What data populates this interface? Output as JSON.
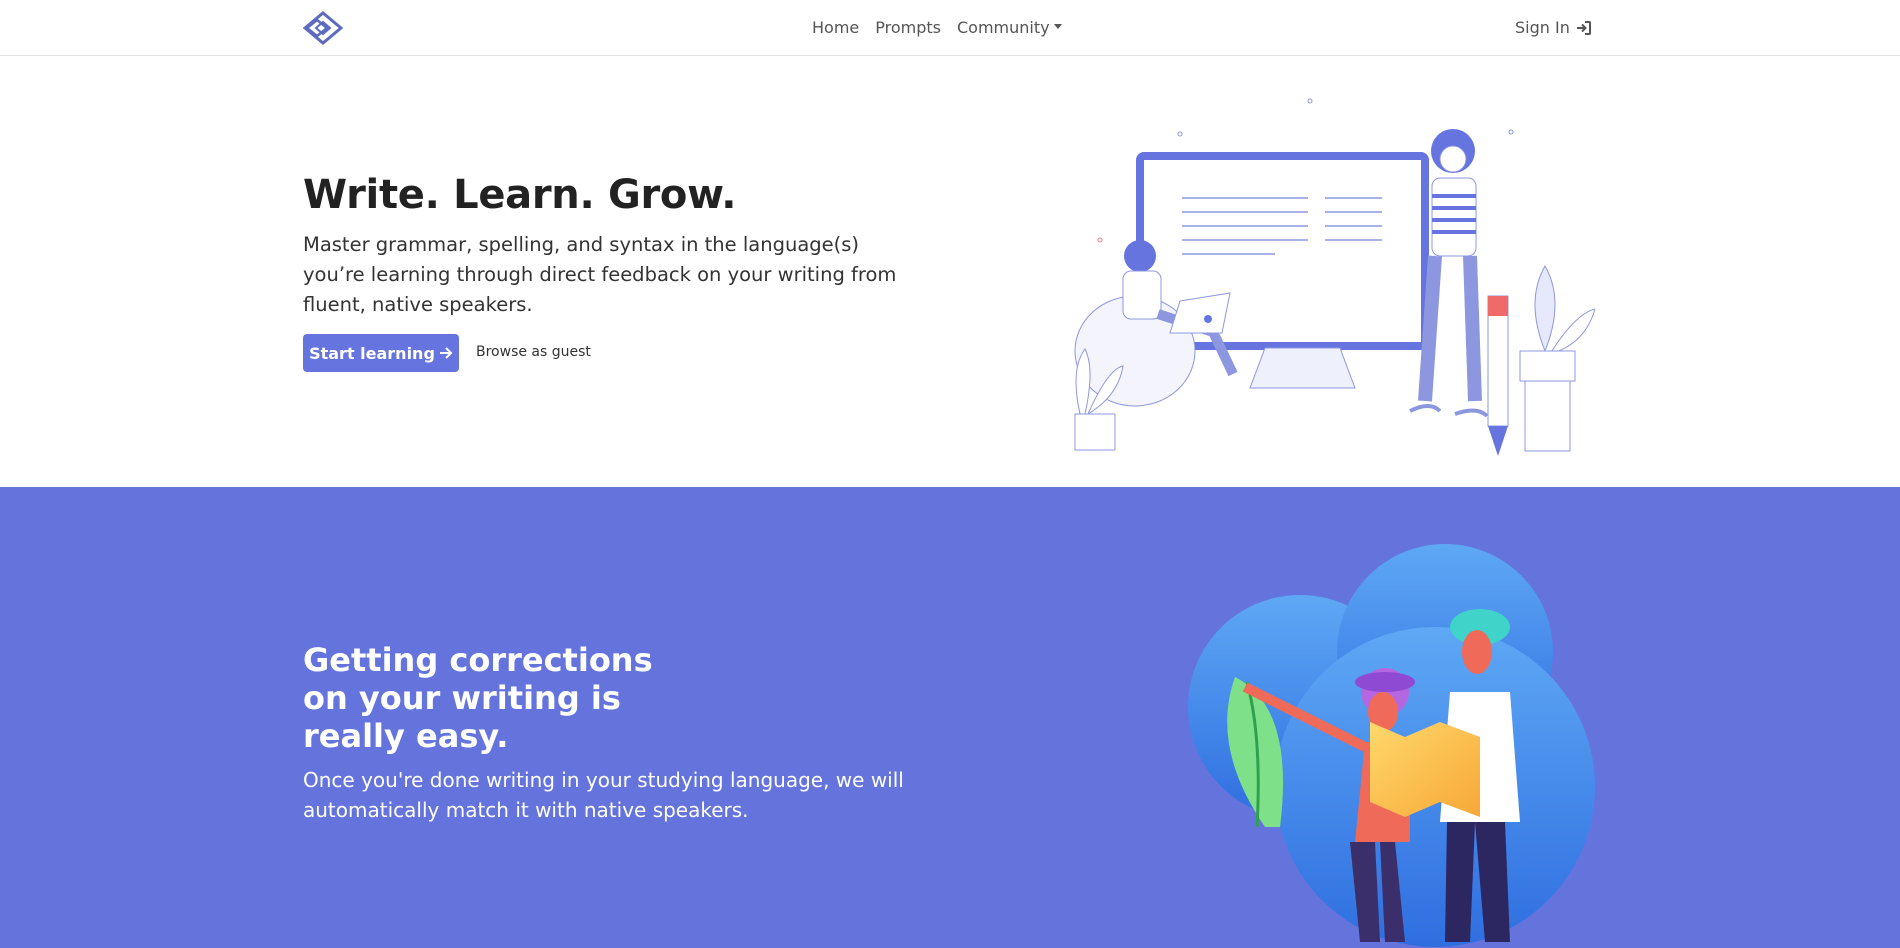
{
  "nav": {
    "links": [
      {
        "label": "Home"
      },
      {
        "label": "Prompts"
      },
      {
        "label": "Community"
      }
    ],
    "signin_label": "Sign In"
  },
  "hero": {
    "title": "Write. Learn. Grow.",
    "subtitle": "Master grammar, spelling, and syntax in the language(s) you’re learning through direct feedback on your writing from fluent, native speakers.",
    "primary_button": "Start learning",
    "secondary_link": "Browse as guest"
  },
  "feature": {
    "title": "Getting corrections on your writing is really easy.",
    "text": "Once you're done writing in your studying language, we will automatically match it with native speakers."
  },
  "colors": {
    "accent": "#6574de",
    "feature_bg": "#6474dc"
  }
}
